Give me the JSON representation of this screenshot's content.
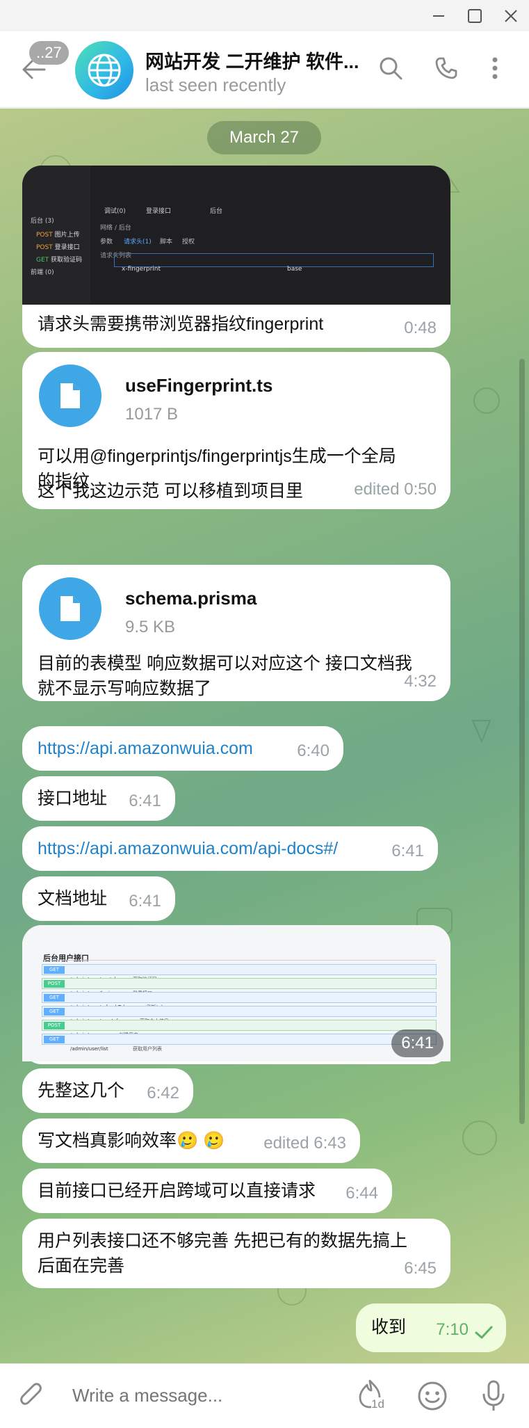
{
  "window": {
    "minimize_label": "minimize",
    "maximize_label": "maximize",
    "close_label": "close"
  },
  "header": {
    "unread_count": "..27",
    "title": "网站开发 二开维护 软件...",
    "status": "last seen recently"
  },
  "chat": {
    "date": "March 27",
    "messages": [
      {
        "type": "image",
        "screenshot": {
          "sidebar": [
            {
              "method": "",
              "label": "后台 (3)"
            },
            {
              "method": "POST",
              "label": "图片上传"
            },
            {
              "method": "POST",
              "label": "登录接口"
            },
            {
              "method": "GET",
              "label": "获取验证码"
            },
            {
              "method": "",
              "label": "前端 (0)"
            }
          ],
          "tabs": [
            "调试(0)",
            "登录接口",
            "后台"
          ],
          "breadcrumb": "网络 / 后台",
          "subtabs": [
            "参数",
            "请求头(1)",
            "脚本",
            "授权"
          ],
          "header_list_label": "请求头列表",
          "row_key": "x-fingerprint",
          "row_value": "base"
        },
        "text": "请求头需要携带浏览器指纹fingerprint",
        "time": "0:48"
      },
      {
        "type": "file",
        "file_name": "useFingerprint.ts",
        "file_size": "1017 B",
        "text_line1": "可以用@fingerprintjs/fingerprintjs生成一个全局",
        "text_line2": "的指纹",
        "text_line3": "这个我这边示范 可以移植到项目里",
        "time": "edited 0:50"
      },
      {
        "type": "file",
        "file_name": "schema.prisma",
        "file_size": "9.5 KB",
        "text_line1": "目前的表模型 响应数据可以对应这个  接口文档我",
        "text_line2": "就不显示写响应数据了",
        "time": "4:32"
      },
      {
        "type": "link",
        "text": "https://api.amazonwuia.com",
        "time": "6:40"
      },
      {
        "type": "text",
        "text": "接口地址",
        "time": "6:41"
      },
      {
        "type": "link",
        "text": "https://api.amazonwuia.com/api-docs#/",
        "time": "6:41"
      },
      {
        "type": "text",
        "text": "文档地址",
        "time": "6:41"
      },
      {
        "type": "image",
        "screenshot": {
          "title": "后台用户接口",
          "rows": [
            {
              "method": "GET",
              "path": "/admin/user/captcha",
              "desc": "获取验证码"
            },
            {
              "method": "POST",
              "path": "/admin/user/login",
              "desc": "登录接口"
            },
            {
              "method": "GET",
              "path": "/admin/user/refreshToken",
              "desc": "刷新token"
            },
            {
              "method": "GET",
              "path": "/admin/user/userInfo",
              "desc": "获取个人信息"
            },
            {
              "method": "POST",
              "path": "/admin/user",
              "desc": "创建用户"
            },
            {
              "method": "GET",
              "path": "/admin/user/list",
              "desc": "获取用户列表"
            }
          ]
        },
        "time": "6:41"
      },
      {
        "type": "text",
        "text": "先整这几个",
        "time": "6:42"
      },
      {
        "type": "text",
        "text": "写文档真影响效率",
        "emoji": "🥲 🥲",
        "time": "edited 6:43"
      },
      {
        "type": "text",
        "text": "目前接口已经开启跨域可以直接请求",
        "time": "6:44"
      },
      {
        "type": "text",
        "text_line1": "用户列表接口还不够完善 先把已有的数据先搞上",
        "text_line2": "后面在完善",
        "time": "6:45"
      },
      {
        "type": "outgoing",
        "text": "收到",
        "time": "7:10"
      }
    ]
  },
  "composer": {
    "placeholder": "Write a message...",
    "timer_badge": "1d"
  },
  "colors": {
    "accent": "#3fa7e6",
    "link": "#1f82c9",
    "outgoing_bubble": "#effdde",
    "check": "#5fb067"
  },
  "icons": [
    "back-arrow-icon",
    "globe-icon",
    "search-icon",
    "phone-icon",
    "more-vertical-icon",
    "file-icon",
    "attach-icon",
    "timer-icon",
    "emoji-icon",
    "microphone-icon",
    "check-icon"
  ]
}
